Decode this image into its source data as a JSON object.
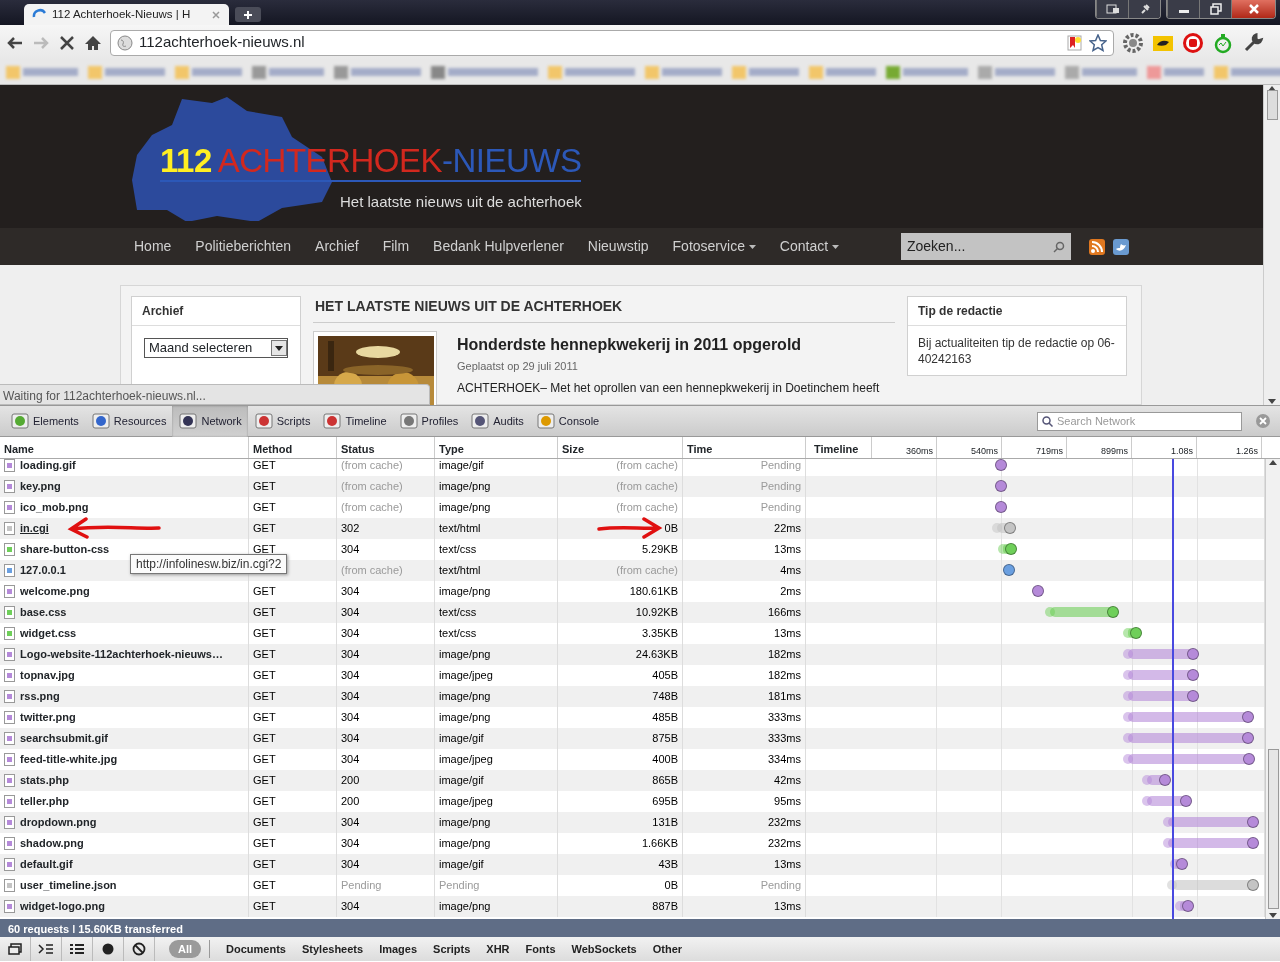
{
  "browser": {
    "tab_title": "112 Achterhoek-Nieuws | H",
    "loading": true,
    "url": "112achterhoek-nieuws.nl"
  },
  "site": {
    "logo": {
      "number": "112",
      "word1": "ACHTERHOEK",
      "dash": "-",
      "word2": "NIEUWS",
      "tagline": "Het laatste nieuws uit de achterhoek"
    },
    "nav": [
      {
        "label": "Home",
        "dropdown": false
      },
      {
        "label": "Politieberichten",
        "dropdown": false
      },
      {
        "label": "Archief",
        "dropdown": false
      },
      {
        "label": "Film",
        "dropdown": false
      },
      {
        "label": "Bedank Hulpverlener",
        "dropdown": false
      },
      {
        "label": "Nieuwstip",
        "dropdown": false
      },
      {
        "label": "Fotoservice",
        "dropdown": true
      },
      {
        "label": "Contact",
        "dropdown": true
      }
    ],
    "search": {
      "placeholder": "Zoeken..."
    },
    "archive": {
      "title": "Archief",
      "select": "Maand selecteren"
    },
    "news": {
      "heading": "HET LAATSTE NIEUWS UIT DE ACHTERHOEK",
      "title": "Honderdste hennepkwekerij in 2011 opgerold",
      "date": "Geplaatst op 29 juli 2011",
      "excerpt": "ACHTERHOEK– Met het oprollen van een hennepkwekerij in Doetinchem heeft"
    },
    "tip": {
      "title": "Tip de redactie",
      "text": "Bij actualiteiten tip de redactie op 06-40242163"
    },
    "status_bubble": "Waiting for 112achterhoek-nieuws.nl..."
  },
  "devtools": {
    "panels": [
      {
        "label": "Elements",
        "selected": false
      },
      {
        "label": "Resources",
        "selected": false
      },
      {
        "label": "Network",
        "selected": true
      },
      {
        "label": "Scripts",
        "selected": false
      },
      {
        "label": "Timeline",
        "selected": false
      },
      {
        "label": "Profiles",
        "selected": false
      },
      {
        "label": "Audits",
        "selected": false
      },
      {
        "label": "Console",
        "selected": false
      }
    ],
    "search": {
      "placeholder": "Search Network"
    },
    "columns": [
      "Name",
      "Method",
      "Status",
      "Type",
      "Size",
      "Time",
      "Timeline"
    ],
    "ticks": [
      "360ms",
      "540ms",
      "719ms",
      "899ms",
      "1.08s",
      "1.26s"
    ],
    "marker": {
      "level": 0.797
    },
    "rows": [
      {
        "hovered": false,
        "cells": [
          {
            "text": "loading.gif"
          },
          {
            "text": "GET",
            "greyed": false
          },
          {
            "text": "(from cache)",
            "greyed": true
          },
          {
            "text": "image/gif",
            "greyed": false
          },
          {
            "text": "(from cache)",
            "greyed": true
          },
          {
            "text": "Pending",
            "greyed": true
          }
        ],
        "bar": {
          "start": {
            "level": 0.425
          },
          "end": {
            "level": 0.425
          }
        }
      },
      {
        "hovered": false,
        "cells": [
          {
            "text": "key.png"
          },
          {
            "text": "GET",
            "greyed": false
          },
          {
            "text": "(from cache)",
            "greyed": true
          },
          {
            "text": "image/png",
            "greyed": false
          },
          {
            "text": "(from cache)",
            "greyed": true
          },
          {
            "text": "Pending",
            "greyed": true
          }
        ],
        "bar": {
          "start": {
            "level": 0.425
          },
          "end": {
            "level": 0.425
          }
        }
      },
      {
        "hovered": false,
        "cells": [
          {
            "text": "ico_mob.png"
          },
          {
            "text": "GET",
            "greyed": false
          },
          {
            "text": "(from cache)",
            "greyed": true
          },
          {
            "text": "image/png",
            "greyed": false
          },
          {
            "text": "(from cache)",
            "greyed": true
          },
          {
            "text": "Pending",
            "greyed": true
          }
        ],
        "bar": {
          "start": {
            "level": 0.425
          },
          "end": {
            "level": 0.425
          }
        }
      },
      {
        "kind": "redirect",
        "hovered": true,
        "cells": [
          {
            "text": "in.cgi"
          },
          {
            "text": "GET",
            "greyed": false
          },
          {
            "text": "302",
            "greyed": false
          },
          {
            "text": "text/html",
            "greyed": false
          },
          {
            "text": "0B",
            "greyed": false
          },
          {
            "text": "22ms",
            "greyed": false
          }
        ],
        "bar": {
          "start": {
            "level": 0.416
          },
          "end": {
            "level": 0.444
          }
        }
      },
      {
        "kind": "stylesheet",
        "hovered": false,
        "cells": [
          {
            "text": "share-button-css"
          },
          {
            "text": "GET",
            "greyed": false
          },
          {
            "text": "304",
            "greyed": false
          },
          {
            "text": "text/css",
            "greyed": false
          },
          {
            "text": "5.29KB",
            "greyed": false
          },
          {
            "text": "13ms",
            "greyed": false
          }
        ],
        "bar": {
          "start": {
            "level": 0.429
          },
          "end": {
            "level": 0.447
          }
        }
      },
      {
        "kind": "document",
        "hovered": false,
        "cells": [
          {
            "text": "127.0.0.1"
          },
          {
            "text": ""
          },
          {
            "text": "(from cache)",
            "greyed": true
          },
          {
            "text": "text/html",
            "greyed": false
          },
          {
            "text": "(from cache)",
            "greyed": true
          },
          {
            "text": "4ms",
            "greyed": false
          }
        ],
        "bar": {
          "start": {
            "level": 0.442
          },
          "end": {
            "level": 0.442
          }
        }
      },
      {
        "hovered": false,
        "cells": [
          {
            "text": "welcome.png"
          },
          {
            "text": "GET",
            "greyed": false
          },
          {
            "text": "304",
            "greyed": false
          },
          {
            "text": "image/png",
            "greyed": false
          },
          {
            "text": "180.61KB",
            "greyed": false
          },
          {
            "text": "2ms",
            "greyed": false
          }
        ],
        "bar": {
          "start": {
            "level": 0.505
          },
          "end": {
            "level": 0.505
          }
        }
      },
      {
        "kind": "stylesheet",
        "hovered": false,
        "cells": [
          {
            "text": "base.css"
          },
          {
            "text": "GET",
            "greyed": false
          },
          {
            "text": "304",
            "greyed": false
          },
          {
            "text": "text/css",
            "greyed": false
          },
          {
            "text": "10.92KB",
            "greyed": false
          },
          {
            "text": "166ms",
            "greyed": false
          }
        ],
        "bar": {
          "start": {
            "level": 0.532
          },
          "end": {
            "level": 0.669
          }
        }
      },
      {
        "kind": "stylesheet",
        "hovered": false,
        "cells": [
          {
            "text": "widget.css"
          },
          {
            "text": "GET",
            "greyed": false
          },
          {
            "text": "304",
            "greyed": false
          },
          {
            "text": "text/css",
            "greyed": false
          },
          {
            "text": "3.35KB",
            "greyed": false
          },
          {
            "text": "13ms",
            "greyed": false
          }
        ],
        "bar": {
          "start": {
            "level": 0.702
          },
          "end": {
            "level": 0.719
          }
        }
      },
      {
        "hovered": false,
        "cells": [
          {
            "text": "Logo-website-112achterhoek-nieuws…"
          },
          {
            "text": "GET",
            "greyed": false
          },
          {
            "text": "304",
            "greyed": false
          },
          {
            "text": "image/png",
            "greyed": false
          },
          {
            "text": "24.63KB",
            "greyed": false
          },
          {
            "text": "182ms",
            "greyed": false
          }
        ],
        "bar": {
          "start": {
            "level": 0.702
          },
          "end": {
            "level": 0.843
          }
        }
      },
      {
        "hovered": false,
        "cells": [
          {
            "text": "topnav.jpg"
          },
          {
            "text": "GET",
            "greyed": false
          },
          {
            "text": "304",
            "greyed": false
          },
          {
            "text": "image/jpeg",
            "greyed": false
          },
          {
            "text": "405B",
            "greyed": false
          },
          {
            "text": "182ms",
            "greyed": false
          }
        ],
        "bar": {
          "start": {
            "level": 0.702
          },
          "end": {
            "level": 0.843
          }
        }
      },
      {
        "hovered": false,
        "cells": [
          {
            "text": "rss.png"
          },
          {
            "text": "GET",
            "greyed": false
          },
          {
            "text": "304",
            "greyed": false
          },
          {
            "text": "image/png",
            "greyed": false
          },
          {
            "text": "748B",
            "greyed": false
          },
          {
            "text": "181ms",
            "greyed": false
          }
        ],
        "bar": {
          "start": {
            "level": 0.702
          },
          "end": {
            "level": 0.843
          }
        }
      },
      {
        "hovered": false,
        "cells": [
          {
            "text": "twitter.png"
          },
          {
            "text": "GET",
            "greyed": false
          },
          {
            "text": "304",
            "greyed": false
          },
          {
            "text": "image/png",
            "greyed": false
          },
          {
            "text": "485B",
            "greyed": false
          },
          {
            "text": "333ms",
            "greyed": false
          }
        ],
        "bar": {
          "start": {
            "level": 0.702
          },
          "end": {
            "level": 0.963
          }
        }
      },
      {
        "hovered": false,
        "cells": [
          {
            "text": "searchsubmit.gif"
          },
          {
            "text": "GET",
            "greyed": false
          },
          {
            "text": "304",
            "greyed": false
          },
          {
            "text": "image/gif",
            "greyed": false
          },
          {
            "text": "875B",
            "greyed": false
          },
          {
            "text": "333ms",
            "greyed": false
          }
        ],
        "bar": {
          "start": {
            "level": 0.702
          },
          "end": {
            "level": 0.963
          }
        }
      },
      {
        "hovered": false,
        "cells": [
          {
            "text": "feed-title-white.jpg"
          },
          {
            "text": "GET",
            "greyed": false
          },
          {
            "text": "304",
            "greyed": false
          },
          {
            "text": "image/jpeg",
            "greyed": false
          },
          {
            "text": "400B",
            "greyed": false
          },
          {
            "text": "334ms",
            "greyed": false
          }
        ],
        "bar": {
          "start": {
            "level": 0.702
          },
          "end": {
            "level": 0.965
          }
        }
      },
      {
        "hovered": false,
        "cells": [
          {
            "text": "stats.php"
          },
          {
            "text": "GET",
            "greyed": false
          },
          {
            "text": "200",
            "greyed": false
          },
          {
            "text": "image/gif",
            "greyed": false
          },
          {
            "text": "865B",
            "greyed": false
          },
          {
            "text": "42ms",
            "greyed": false
          }
        ],
        "bar": {
          "start": {
            "level": 0.743
          },
          "end": {
            "level": 0.782
          }
        }
      },
      {
        "hovered": false,
        "cells": [
          {
            "text": "teller.php"
          },
          {
            "text": "GET",
            "greyed": false
          },
          {
            "text": "200",
            "greyed": false
          },
          {
            "text": "image/jpeg",
            "greyed": false
          },
          {
            "text": "695B",
            "greyed": false
          },
          {
            "text": "95ms",
            "greyed": false
          }
        ],
        "bar": {
          "start": {
            "level": 0.743
          },
          "end": {
            "level": 0.828
          }
        }
      },
      {
        "hovered": false,
        "cells": [
          {
            "text": "dropdown.png"
          },
          {
            "text": "GET",
            "greyed": false
          },
          {
            "text": "304",
            "greyed": false
          },
          {
            "text": "image/png",
            "greyed": false
          },
          {
            "text": "131B",
            "greyed": false
          },
          {
            "text": "232ms",
            "greyed": false
          }
        ],
        "bar": {
          "start": {
            "level": 0.789
          },
          "end": {
            "level": 0.974
          }
        }
      },
      {
        "hovered": false,
        "cells": [
          {
            "text": "shadow.png"
          },
          {
            "text": "GET",
            "greyed": false
          },
          {
            "text": "304",
            "greyed": false
          },
          {
            "text": "image/png",
            "greyed": false
          },
          {
            "text": "1.66KB",
            "greyed": false
          },
          {
            "text": "232ms",
            "greyed": false
          }
        ],
        "bar": {
          "start": {
            "level": 0.789
          },
          "end": {
            "level": 0.974
          }
        }
      },
      {
        "hovered": false,
        "cells": [
          {
            "text": "default.gif"
          },
          {
            "text": "GET",
            "greyed": false
          },
          {
            "text": "304",
            "greyed": false
          },
          {
            "text": "image/gif",
            "greyed": false
          },
          {
            "text": "43B",
            "greyed": false
          },
          {
            "text": "13ms",
            "greyed": false
          }
        ],
        "bar": {
          "start": {
            "level": 0.804
          },
          "end": {
            "level": 0.819
          }
        }
      },
      {
        "kind": "pending",
        "hovered": false,
        "cells": [
          {
            "text": "user_timeline.json"
          },
          {
            "text": "GET",
            "greyed": false
          },
          {
            "text": "Pending",
            "greyed": true
          },
          {
            "text": "Pending",
            "greyed": true
          },
          {
            "text": "0B",
            "greyed": false
          },
          {
            "text": "Pending",
            "greyed": true
          }
        ],
        "bar": {
          "start": {
            "level": 0.797
          },
          "end": {
            "level": 0.974
          }
        }
      },
      {
        "hovered": false,
        "cells": [
          {
            "text": "widget-logo.png"
          },
          {
            "text": "GET",
            "greyed": false
          },
          {
            "text": "304",
            "greyed": false
          },
          {
            "text": "image/png",
            "greyed": false
          },
          {
            "text": "887B",
            "greyed": false
          },
          {
            "text": "13ms",
            "greyed": false
          }
        ],
        "bar": {
          "start": {
            "level": 0.815
          },
          "end": {
            "level": 0.832
          }
        }
      }
    ],
    "tooltip": "http://infolinesw.biz/in.cgi?2",
    "summary": "60 requests ǀ 15.60KB transferred",
    "filters": [
      {
        "label": "All",
        "selected": true
      },
      {
        "label": "Documents",
        "selected": false
      },
      {
        "label": "Stylesheets",
        "selected": false
      },
      {
        "label": "Images",
        "selected": false
      },
      {
        "label": "Scripts",
        "selected": false
      },
      {
        "label": "XHR",
        "selected": false
      },
      {
        "label": "Fonts",
        "selected": false
      },
      {
        "label": "WebSockets",
        "selected": false
      },
      {
        "label": "Other",
        "selected": false
      }
    ]
  }
}
